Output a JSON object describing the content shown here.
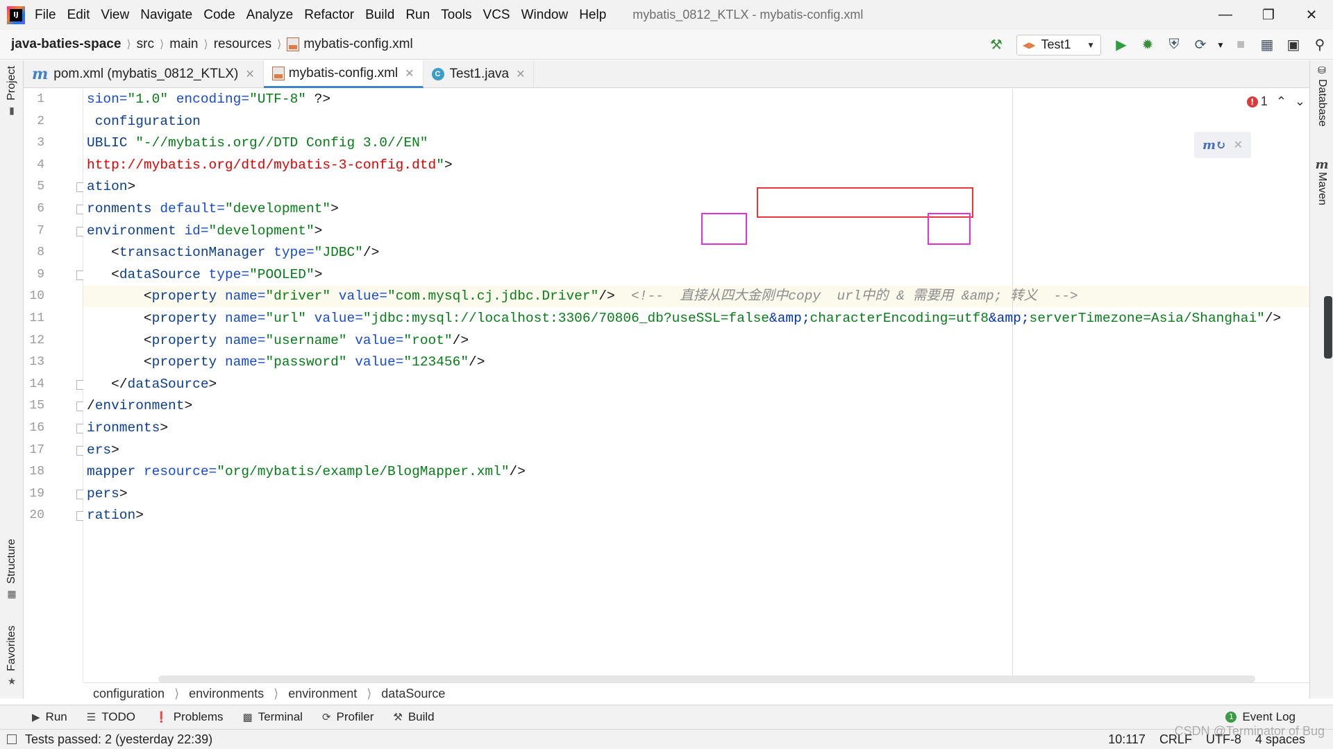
{
  "menu": [
    "File",
    "Edit",
    "View",
    "Navigate",
    "Code",
    "Analyze",
    "Refactor",
    "Build",
    "Run",
    "Tools",
    "VCS",
    "Window",
    "Help"
  ],
  "window_title": "mybatis_0812_KTLX - mybatis-config.xml",
  "nav": {
    "project": "java-baties-space",
    "path": [
      "src",
      "main",
      "resources"
    ],
    "file": "mybatis-config.xml",
    "run_config": "Test1"
  },
  "tabs": [
    {
      "label": "pom.xml (mybatis_0812_KTLX)",
      "active": false
    },
    {
      "label": "mybatis-config.xml",
      "active": true
    },
    {
      "label": "Test1.java",
      "active": false
    }
  ],
  "left_tools": {
    "project": "Project",
    "structure": "Structure",
    "favorites": "Favorites"
  },
  "right_tools": {
    "database": "Database",
    "maven": "Maven"
  },
  "editor": {
    "error_count": "1",
    "current_line": 10,
    "lines": [
      {
        "n": "1",
        "segs": [
          [
            "a",
            "sion="
          ],
          [
            "s",
            "\"1.0\""
          ],
          [
            "a",
            " encoding="
          ],
          [
            "s",
            "\"UTF-8\""
          ],
          [
            "p",
            " ?>"
          ]
        ]
      },
      {
        "n": "2",
        "segs": [
          [
            "t",
            " configuration"
          ]
        ]
      },
      {
        "n": "3",
        "segs": [
          [
            "t",
            "UBLIC "
          ],
          [
            "s",
            "\"-//mybatis.org//DTD Config 3.0//EN\""
          ]
        ]
      },
      {
        "n": "4",
        "segs": [
          [
            "u",
            "http://mybatis.org/dtd/mybatis-3-config.dtd"
          ],
          [
            "s",
            "\""
          ],
          [
            "p",
            ">"
          ]
        ]
      },
      {
        "n": "5",
        "segs": [
          [
            "t",
            "ation"
          ],
          [
            "p",
            ">"
          ]
        ]
      },
      {
        "n": "6",
        "segs": [
          [
            "t",
            "ronments "
          ],
          [
            "a",
            "default="
          ],
          [
            "s",
            "\"development\""
          ],
          [
            "p",
            ">"
          ]
        ]
      },
      {
        "n": "7",
        "segs": [
          [
            "t",
            "environment "
          ],
          [
            "a",
            "id="
          ],
          [
            "s",
            "\"development\""
          ],
          [
            "p",
            ">"
          ]
        ]
      },
      {
        "n": "8",
        "segs": [
          [
            "p",
            "   <"
          ],
          [
            "t",
            "transactionManager "
          ],
          [
            "a",
            "type="
          ],
          [
            "s",
            "\"JDBC\""
          ],
          [
            "p",
            "/>"
          ]
        ]
      },
      {
        "n": "9",
        "segs": [
          [
            "p",
            "   <"
          ],
          [
            "t",
            "dataSource "
          ],
          [
            "a",
            "type="
          ],
          [
            "s",
            "\"POOLED\""
          ],
          [
            "p",
            ">"
          ]
        ]
      },
      {
        "n": "10",
        "segs": [
          [
            "p",
            "       <"
          ],
          [
            "t",
            "property "
          ],
          [
            "a",
            "name="
          ],
          [
            "s",
            "\"driver\""
          ],
          [
            "a",
            " value="
          ],
          [
            "s",
            "\"com.mysql.cj.jdbc.Driver\""
          ],
          [
            "p",
            "/>  "
          ],
          [
            "c",
            "<!--  直接从四大金刚中copy  url中的 & 需要用 &amp; 转义  -->"
          ]
        ]
      },
      {
        "n": "11",
        "segs": [
          [
            "p",
            "       <"
          ],
          [
            "t",
            "property "
          ],
          [
            "a",
            "name="
          ],
          [
            "s",
            "\"url\""
          ],
          [
            "a",
            " value="
          ],
          [
            "s",
            "\"jdbc:mysql://localhost:3306/70806_db?useSSL=false"
          ],
          [
            "e",
            "&amp;"
          ],
          [
            "s",
            "characterEncoding=utf8"
          ],
          [
            "e",
            "&amp;"
          ],
          [
            "s",
            "serverTimezone=Asia/Shanghai\""
          ],
          [
            "p",
            "/>"
          ]
        ]
      },
      {
        "n": "12",
        "segs": [
          [
            "p",
            "       <"
          ],
          [
            "t",
            "property "
          ],
          [
            "a",
            "name="
          ],
          [
            "s",
            "\"username\""
          ],
          [
            "a",
            " value="
          ],
          [
            "s",
            "\"root\""
          ],
          [
            "p",
            "/>"
          ]
        ]
      },
      {
        "n": "13",
        "segs": [
          [
            "p",
            "       <"
          ],
          [
            "t",
            "property "
          ],
          [
            "a",
            "name="
          ],
          [
            "s",
            "\"password\""
          ],
          [
            "a",
            " value="
          ],
          [
            "s",
            "\"123456\""
          ],
          [
            "p",
            "/>"
          ]
        ]
      },
      {
        "n": "14",
        "segs": [
          [
            "p",
            "   </"
          ],
          [
            "t",
            "dataSource"
          ],
          [
            "p",
            ">"
          ]
        ]
      },
      {
        "n": "15",
        "segs": [
          [
            "p",
            "/"
          ],
          [
            "t",
            "environment"
          ],
          [
            "p",
            ">"
          ]
        ]
      },
      {
        "n": "16",
        "segs": [
          [
            "t",
            "ironments"
          ],
          [
            "p",
            ">"
          ]
        ]
      },
      {
        "n": "17",
        "segs": [
          [
            "t",
            "ers"
          ],
          [
            "p",
            ">"
          ]
        ]
      },
      {
        "n": "18",
        "segs": [
          [
            "t",
            "mapper "
          ],
          [
            "a",
            "resource="
          ],
          [
            "s",
            "\"org/mybatis/example/BlogMapper.xml\""
          ],
          [
            "p",
            "/>"
          ]
        ]
      },
      {
        "n": "19",
        "segs": [
          [
            "t",
            "pers"
          ],
          [
            "p",
            ">"
          ]
        ]
      },
      {
        "n": "20",
        "segs": [
          [
            "t",
            "ration"
          ],
          [
            "p",
            ">"
          ]
        ]
      }
    ]
  },
  "structure_path": [
    "configuration",
    "environments",
    "environment",
    "dataSource"
  ],
  "bottom_tools": [
    "Run",
    "TODO",
    "Problems",
    "Terminal",
    "Profiler",
    "Build"
  ],
  "event_log": "Event Log",
  "status": {
    "message": "Tests passed: 2 (yesterday 22:39)",
    "position": "10:117",
    "line_sep": "CRLF",
    "encoding": "UTF-8",
    "indent": "4 spaces"
  },
  "watermark": "CSDN @Terminator of Bug",
  "colors": {
    "accent": "#4083c9",
    "annotation_red": "#e8343a",
    "annotation_magenta": "#e430d8"
  }
}
